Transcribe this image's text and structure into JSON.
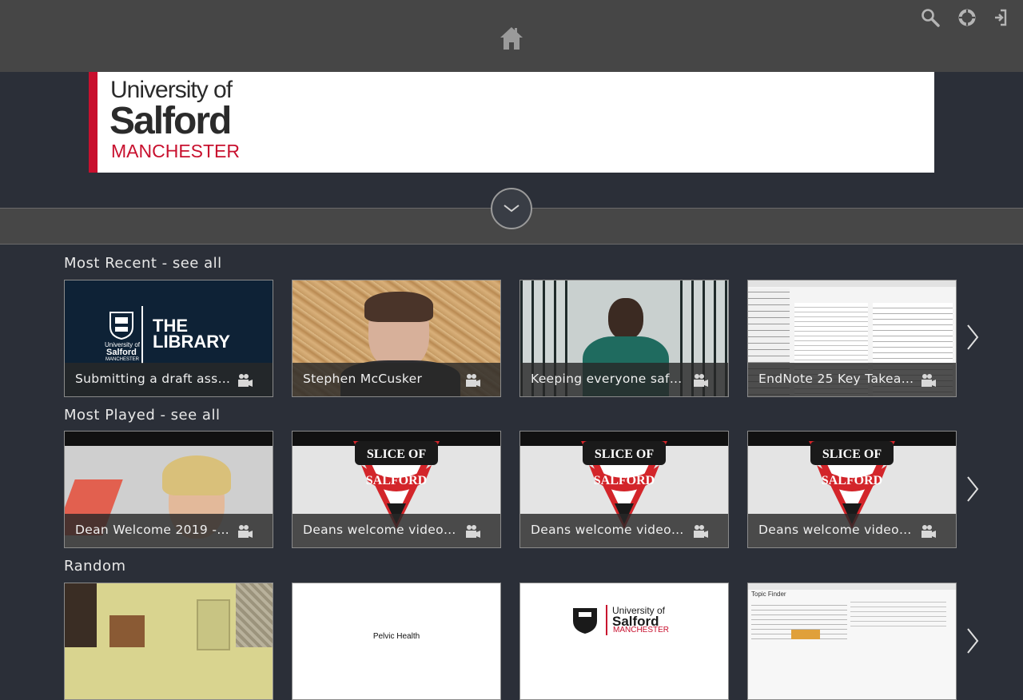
{
  "header": {
    "home_icon": "home-icon",
    "search_icon": "search-icon",
    "help_icon": "lifebuoy-icon",
    "login_icon": "sign-in-icon"
  },
  "banner": {
    "logo_line1": "University of",
    "logo_line2": "Salford",
    "logo_line3": "MANCHESTER",
    "accent_color": "#c8102e"
  },
  "expand": {
    "icon": "chevron-down-icon"
  },
  "sections": [
    {
      "title": "Most Recent - see all",
      "cards": [
        {
          "caption": "Submitting a draft asse…",
          "thumb_text1": "THE",
          "thumb_text2": "LIBRARY",
          "thumb_logo1": "University of",
          "thumb_logo2": "Salford",
          "thumb_logo3": "MANCHESTER"
        },
        {
          "caption": "Stephen McCusker"
        },
        {
          "caption": "Keeping everyone safe …"
        },
        {
          "caption": "EndNote 25 Key Takea…"
        }
      ]
    },
    {
      "title": "Most Played - see all",
      "cards": [
        {
          "caption": "Dean Welcome 2019 - …"
        },
        {
          "caption": "Deans welcome video -…",
          "badge1": "SLICE OF",
          "badge2": "SALFORD"
        },
        {
          "caption": "Deans welcome video -…",
          "badge1": "SLICE OF",
          "badge2": "SALFORD"
        },
        {
          "caption": "Deans welcome video -…",
          "badge1": "SLICE OF",
          "badge2": "SALFORD"
        }
      ]
    },
    {
      "title": "Random",
      "cards": [
        {
          "caption": ""
        },
        {
          "caption": "",
          "thumb_text": "Pelvic Health"
        },
        {
          "caption": "",
          "thumb_logo1": "University of",
          "thumb_logo2": "Salford",
          "thumb_logo3": "MANCHESTER"
        },
        {
          "caption": "",
          "thumb_text": "Topic Finder"
        }
      ]
    }
  ]
}
